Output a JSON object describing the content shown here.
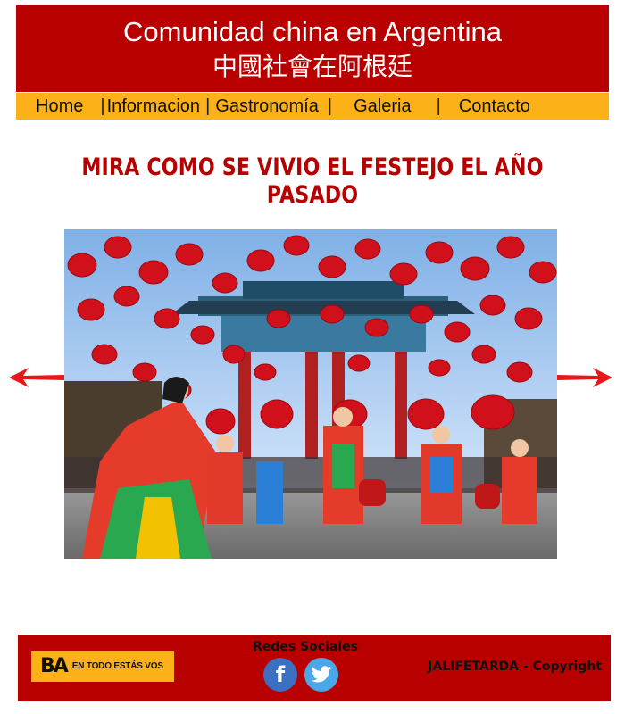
{
  "header": {
    "title": "Comunidad china en Argentina",
    "subtitle": "中國社會在阿根廷"
  },
  "nav": {
    "items": [
      {
        "label": "Home"
      },
      {
        "label": "Informacion"
      },
      {
        "label": "Gastronomía"
      },
      {
        "label": "Galeria"
      },
      {
        "label": "Contacto"
      }
    ],
    "separator": "|"
  },
  "main": {
    "headline": "MIRA COMO SE VIVIO EL FESTEJO EL AÑO PASADO",
    "slideshow": {
      "image": "photo of Chinese New Year festival: dancers in colorful costumes under hanging red lanterns",
      "prev_icon": "red-arrow-left-icon",
      "next_icon": "red-arrow-right-icon"
    }
  },
  "footer": {
    "logo_mark": "BA",
    "logo_tagline": "EN TODO ESTÁS VOS",
    "social_label": "Redes Sociales",
    "facebook_glyph": "f",
    "twitter_icon": "twitter-bird-icon",
    "copyright": "JALIFETARDA - Copyright"
  },
  "colors": {
    "brand_red": "#b80000",
    "nav_yellow": "#fbb117",
    "facebook_blue": "#3b6fc1",
    "twitter_blue": "#4aa8e8"
  }
}
